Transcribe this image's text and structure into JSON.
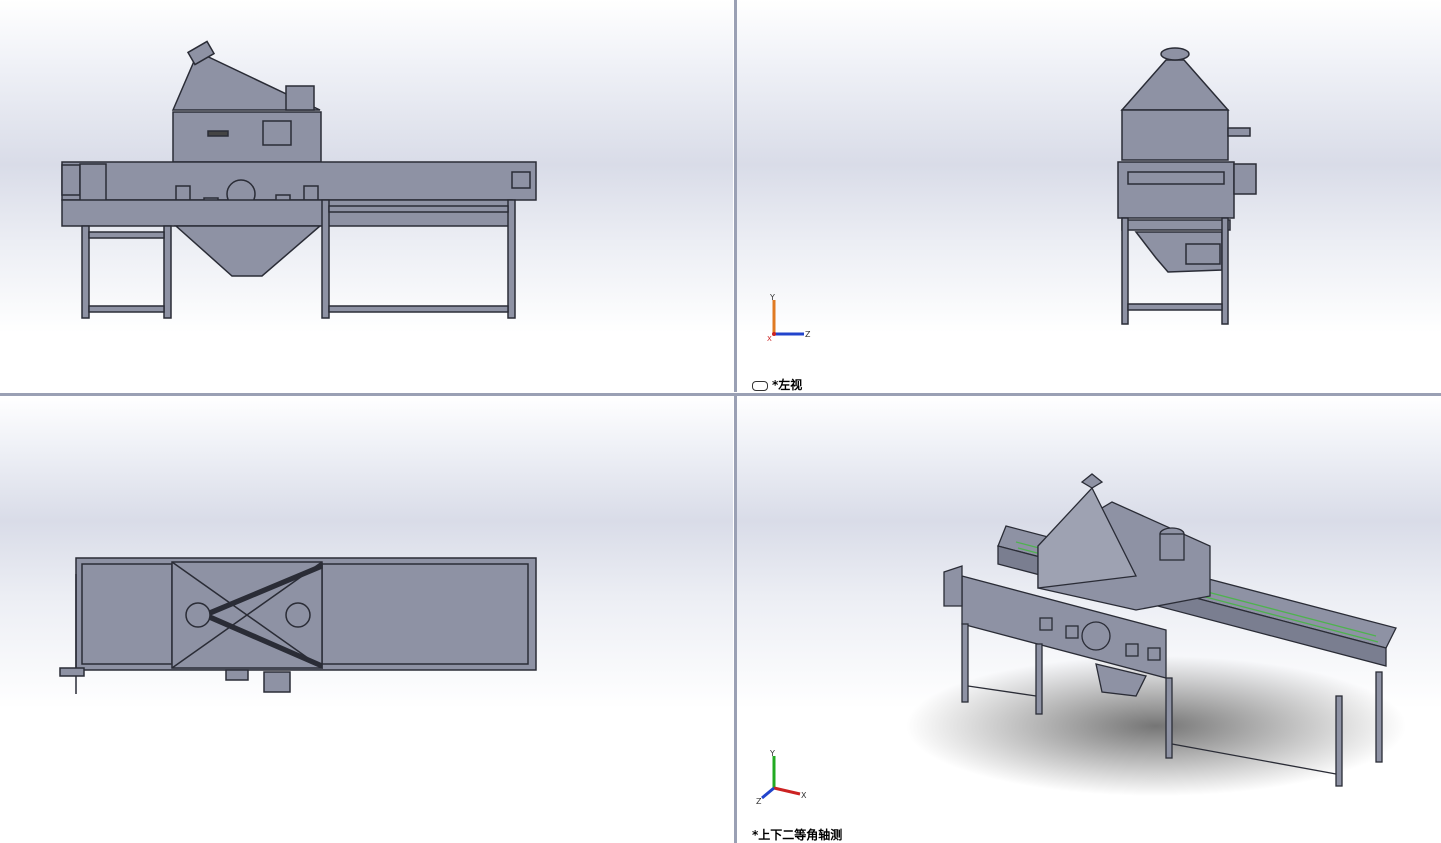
{
  "viewports": {
    "top_right": {
      "view_label": "*左视"
    },
    "bottom_right": {
      "view_label": "*上下二等角轴测"
    }
  },
  "triads": {
    "top_right": {
      "axis_y": "Y",
      "axis_z": "Z",
      "axis_x": "X"
    },
    "bottom_right": {
      "axis_y": "Y",
      "axis_x": "X",
      "axis_z": "Z"
    }
  },
  "colors": {
    "model_face": "#8e92a4",
    "model_edge": "#2a2c36",
    "axis_x": "#cc2222",
    "axis_y": "#22aa22",
    "axis_z": "#2244cc",
    "viewport_border": "#9aa0b4"
  }
}
